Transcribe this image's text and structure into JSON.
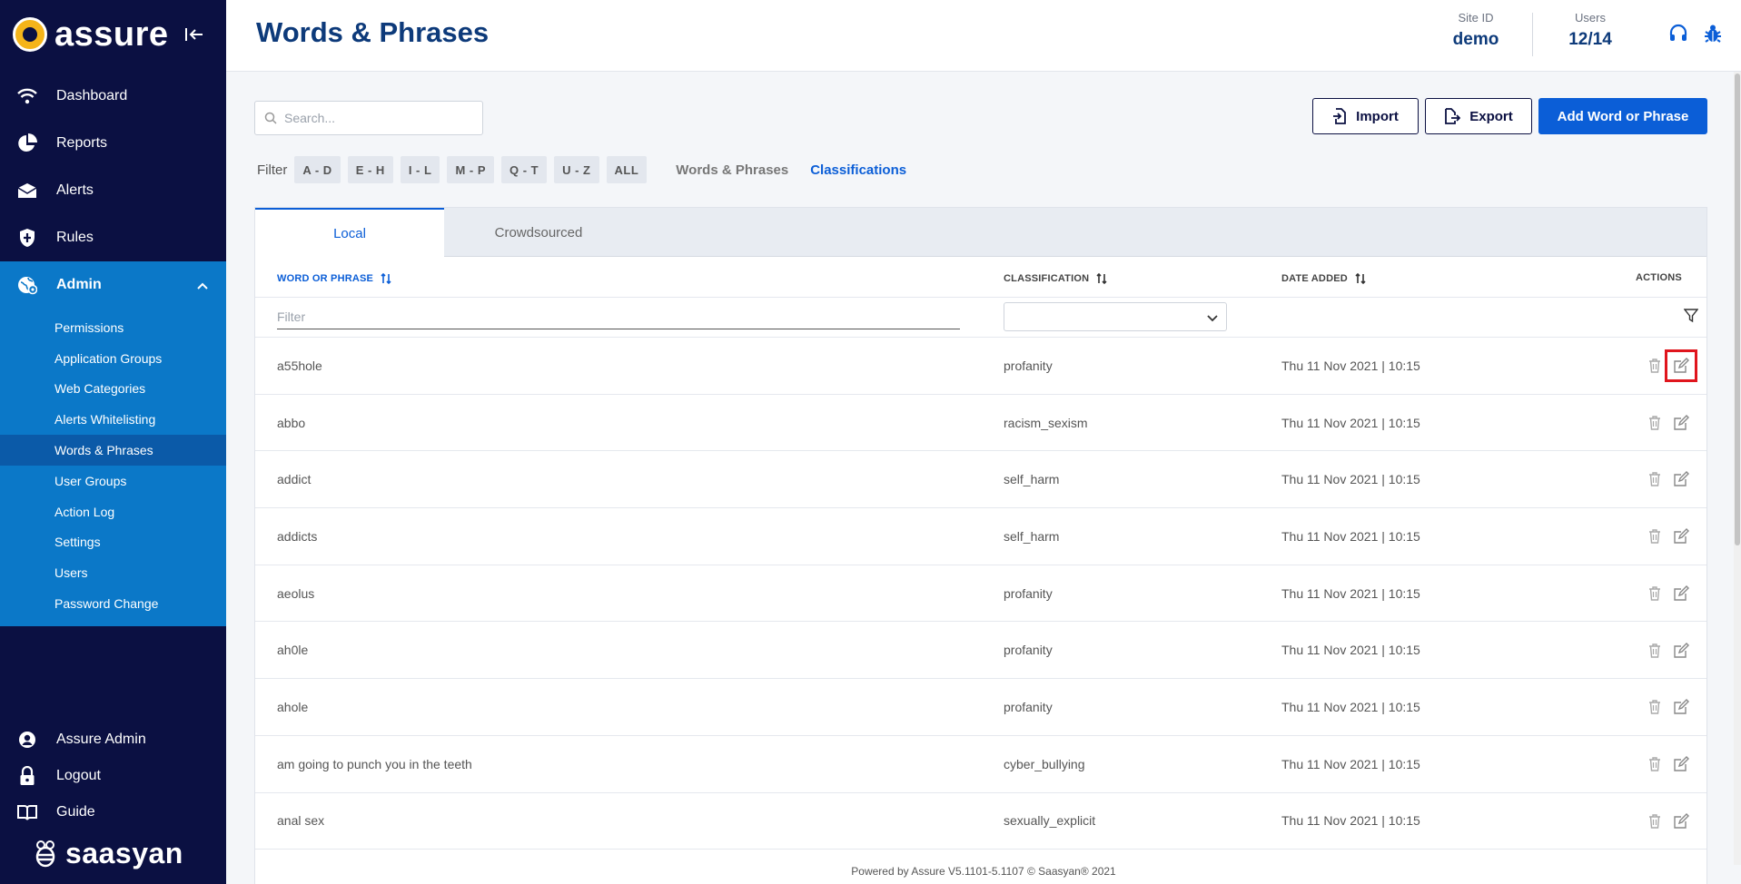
{
  "app": {
    "brand": "assure",
    "footer_brand": "saasyan",
    "footer_text": "Powered by Assure V5.1101-5.1107 © Saasyan® 2021"
  },
  "sidebar": {
    "items": [
      {
        "label": "Dashboard",
        "icon": "wifi-icon"
      },
      {
        "label": "Reports",
        "icon": "pie-chart-icon"
      },
      {
        "label": "Alerts",
        "icon": "envelope-icon"
      },
      {
        "label": "Rules",
        "icon": "shield-icon"
      },
      {
        "label": "Admin",
        "icon": "globe-gear-icon"
      }
    ],
    "admin_sub": [
      "Permissions",
      "Application Groups",
      "Web Categories",
      "Alerts Whitelisting",
      "Words & Phrases",
      "User Groups",
      "Action Log",
      "Settings",
      "Users",
      "Password Change"
    ],
    "active_sub": "Words & Phrases",
    "bottom": [
      {
        "label": "Assure Admin",
        "icon": "user-icon"
      },
      {
        "label": "Logout",
        "icon": "lock-icon"
      },
      {
        "label": "Guide",
        "icon": "book-icon"
      }
    ]
  },
  "header": {
    "title": "Words & Phrases",
    "site_id_label": "Site ID",
    "site_id_value": "demo",
    "users_label": "Users",
    "users_value": "12/14"
  },
  "toolbar": {
    "search_placeholder": "Search...",
    "import_label": "Import",
    "export_label": "Export",
    "add_label": "Add Word or Phrase"
  },
  "filters": {
    "label": "Filter",
    "ranges": [
      "A - D",
      "E - H",
      "I - L",
      "M - P",
      "Q - T",
      "U - Z",
      "ALL"
    ],
    "views": [
      "Words & Phrases",
      "Classifications"
    ],
    "active_view": "Classifications"
  },
  "tabs": [
    {
      "label": "Local",
      "active": true
    },
    {
      "label": "Crowdsourced",
      "active": false
    }
  ],
  "table": {
    "columns": [
      "WORD OR PHRASE",
      "CLASSIFICATION",
      "DATE ADDED",
      "ACTIONS"
    ],
    "filter_placeholder": "Filter",
    "rows": [
      {
        "word": "a55hole",
        "classification": "profanity",
        "date": "Thu 11 Nov 2021 | 10:15"
      },
      {
        "word": "abbo",
        "classification": "racism_sexism",
        "date": "Thu 11 Nov 2021 | 10:15"
      },
      {
        "word": "addict",
        "classification": "self_harm",
        "date": "Thu 11 Nov 2021 | 10:15"
      },
      {
        "word": "addicts",
        "classification": "self_harm",
        "date": "Thu 11 Nov 2021 | 10:15"
      },
      {
        "word": "aeolus",
        "classification": "profanity",
        "date": "Thu 11 Nov 2021 | 10:15"
      },
      {
        "word": "ah0le",
        "classification": "profanity",
        "date": "Thu 11 Nov 2021 | 10:15"
      },
      {
        "word": "ahole",
        "classification": "profanity",
        "date": "Thu 11 Nov 2021 | 10:15"
      },
      {
        "word": "am going to punch you in the teeth",
        "classification": "cyber_bullying",
        "date": "Thu 11 Nov 2021 | 10:15"
      },
      {
        "word": "anal sex",
        "classification": "sexually_explicit",
        "date": "Thu 11 Nov 2021 | 10:15"
      }
    ],
    "highlighted_row": 0
  },
  "colors": {
    "sidebar_bg": "#0b1042",
    "admin_bg": "#0b78c8",
    "active_sub_bg": "#0b5aa8",
    "primary": "#0b5ed7",
    "title": "#0d3a7a",
    "highlight": "#e0151d"
  }
}
